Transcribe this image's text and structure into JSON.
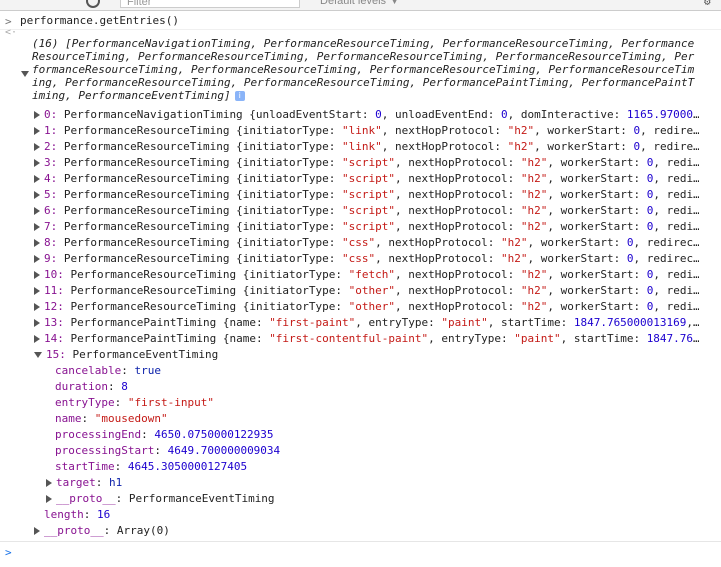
{
  "toolbar": {
    "filter_placeholder": "Filter",
    "levels_label": "Default levels ▼"
  },
  "input": {
    "prompt": ">",
    "command": "performance.getEntries()"
  },
  "output": {
    "prompt": "<·",
    "summary": "(16) [PerformanceNavigationTiming, PerformanceResourceTiming, PerformanceResourceTiming, PerformanceResourceTiming, PerformanceResourceTiming, PerformanceResourceTiming, PerformanceResourceTiming, PerformanceResourceTiming, PerformanceResourceTiming, PerformanceResourceTiming, PerformanceResourceTiming, PerformanceResourceTiming, PerformanceResourceTiming, PerformancePaintTiming, PerformancePaintTiming, PerformanceEventTiming]",
    "entries": [
      {
        "idx": "0:",
        "cls": "PerformanceNavigationTiming",
        "rest": " {unloadEventStart: 0, unloadEventEnd: 0, domInteractive: 1165.97000…"
      },
      {
        "idx": "1:",
        "cls": "PerformanceResourceTiming",
        "rest": " {initiatorType: \"link\", nextHopProtocol: \"h2\", workerStart: 0, redire…"
      },
      {
        "idx": "2:",
        "cls": "PerformanceResourceTiming",
        "rest": " {initiatorType: \"link\", nextHopProtocol: \"h2\", workerStart: 0, redire…"
      },
      {
        "idx": "3:",
        "cls": "PerformanceResourceTiming",
        "rest": " {initiatorType: \"script\", nextHopProtocol: \"h2\", workerStart: 0, redi…"
      },
      {
        "idx": "4:",
        "cls": "PerformanceResourceTiming",
        "rest": " {initiatorType: \"script\", nextHopProtocol: \"h2\", workerStart: 0, redi…"
      },
      {
        "idx": "5:",
        "cls": "PerformanceResourceTiming",
        "rest": " {initiatorType: \"script\", nextHopProtocol: \"h2\", workerStart: 0, redi…"
      },
      {
        "idx": "6:",
        "cls": "PerformanceResourceTiming",
        "rest": " {initiatorType: \"script\", nextHopProtocol: \"h2\", workerStart: 0, redi…"
      },
      {
        "idx": "7:",
        "cls": "PerformanceResourceTiming",
        "rest": " {initiatorType: \"script\", nextHopProtocol: \"h2\", workerStart: 0, redi…"
      },
      {
        "idx": "8:",
        "cls": "PerformanceResourceTiming",
        "rest": " {initiatorType: \"css\", nextHopProtocol: \"h2\", workerStart: 0, redirec…"
      },
      {
        "idx": "9:",
        "cls": "PerformanceResourceTiming",
        "rest": " {initiatorType: \"css\", nextHopProtocol: \"h2\", workerStart: 0, redirec…"
      },
      {
        "idx": "10:",
        "cls": "PerformanceResourceTiming",
        "rest": " {initiatorType: \"fetch\", nextHopProtocol: \"h2\", workerStart: 0, redi…"
      },
      {
        "idx": "11:",
        "cls": "PerformanceResourceTiming",
        "rest": " {initiatorType: \"other\", nextHopProtocol: \"h2\", workerStart: 0, redi…"
      },
      {
        "idx": "12:",
        "cls": "PerformanceResourceTiming",
        "rest": " {initiatorType: \"other\", nextHopProtocol: \"h2\", workerStart: 0, redi…"
      },
      {
        "idx": "13:",
        "cls": "PerformancePaintTiming",
        "rest": " {name: \"first-paint\", entryType: \"paint\", startTime: 1847.765000013169,…"
      },
      {
        "idx": "14:",
        "cls": "PerformancePaintTiming",
        "rest": " {name: \"first-contentful-paint\", entryType: \"paint\", startTime: 1847.76…"
      }
    ],
    "expanded": {
      "idx": "15:",
      "cls": "PerformanceEventTiming",
      "props": [
        {
          "k": "cancelable",
          "v": "true",
          "t": "kw"
        },
        {
          "k": "duration",
          "v": "8",
          "t": "num"
        },
        {
          "k": "entryType",
          "v": "\"first-input\"",
          "t": "str"
        },
        {
          "k": "name",
          "v": "\"mousedown\"",
          "t": "str"
        },
        {
          "k": "processingEnd",
          "v": "4650.0750000122935",
          "t": "num"
        },
        {
          "k": "processingStart",
          "v": "4649.700000009034",
          "t": "num"
        },
        {
          "k": "startTime",
          "v": "4645.3050000127405",
          "t": "num"
        }
      ],
      "target_key": "target",
      "target_val": "h1",
      "proto_key": "__proto__",
      "proto_val": "PerformanceEventTiming"
    },
    "length_key": "length",
    "length_val": "16",
    "array_proto_key": "__proto__",
    "array_proto_val": "Array(0)"
  },
  "bottom": {
    "prompt": ">"
  }
}
